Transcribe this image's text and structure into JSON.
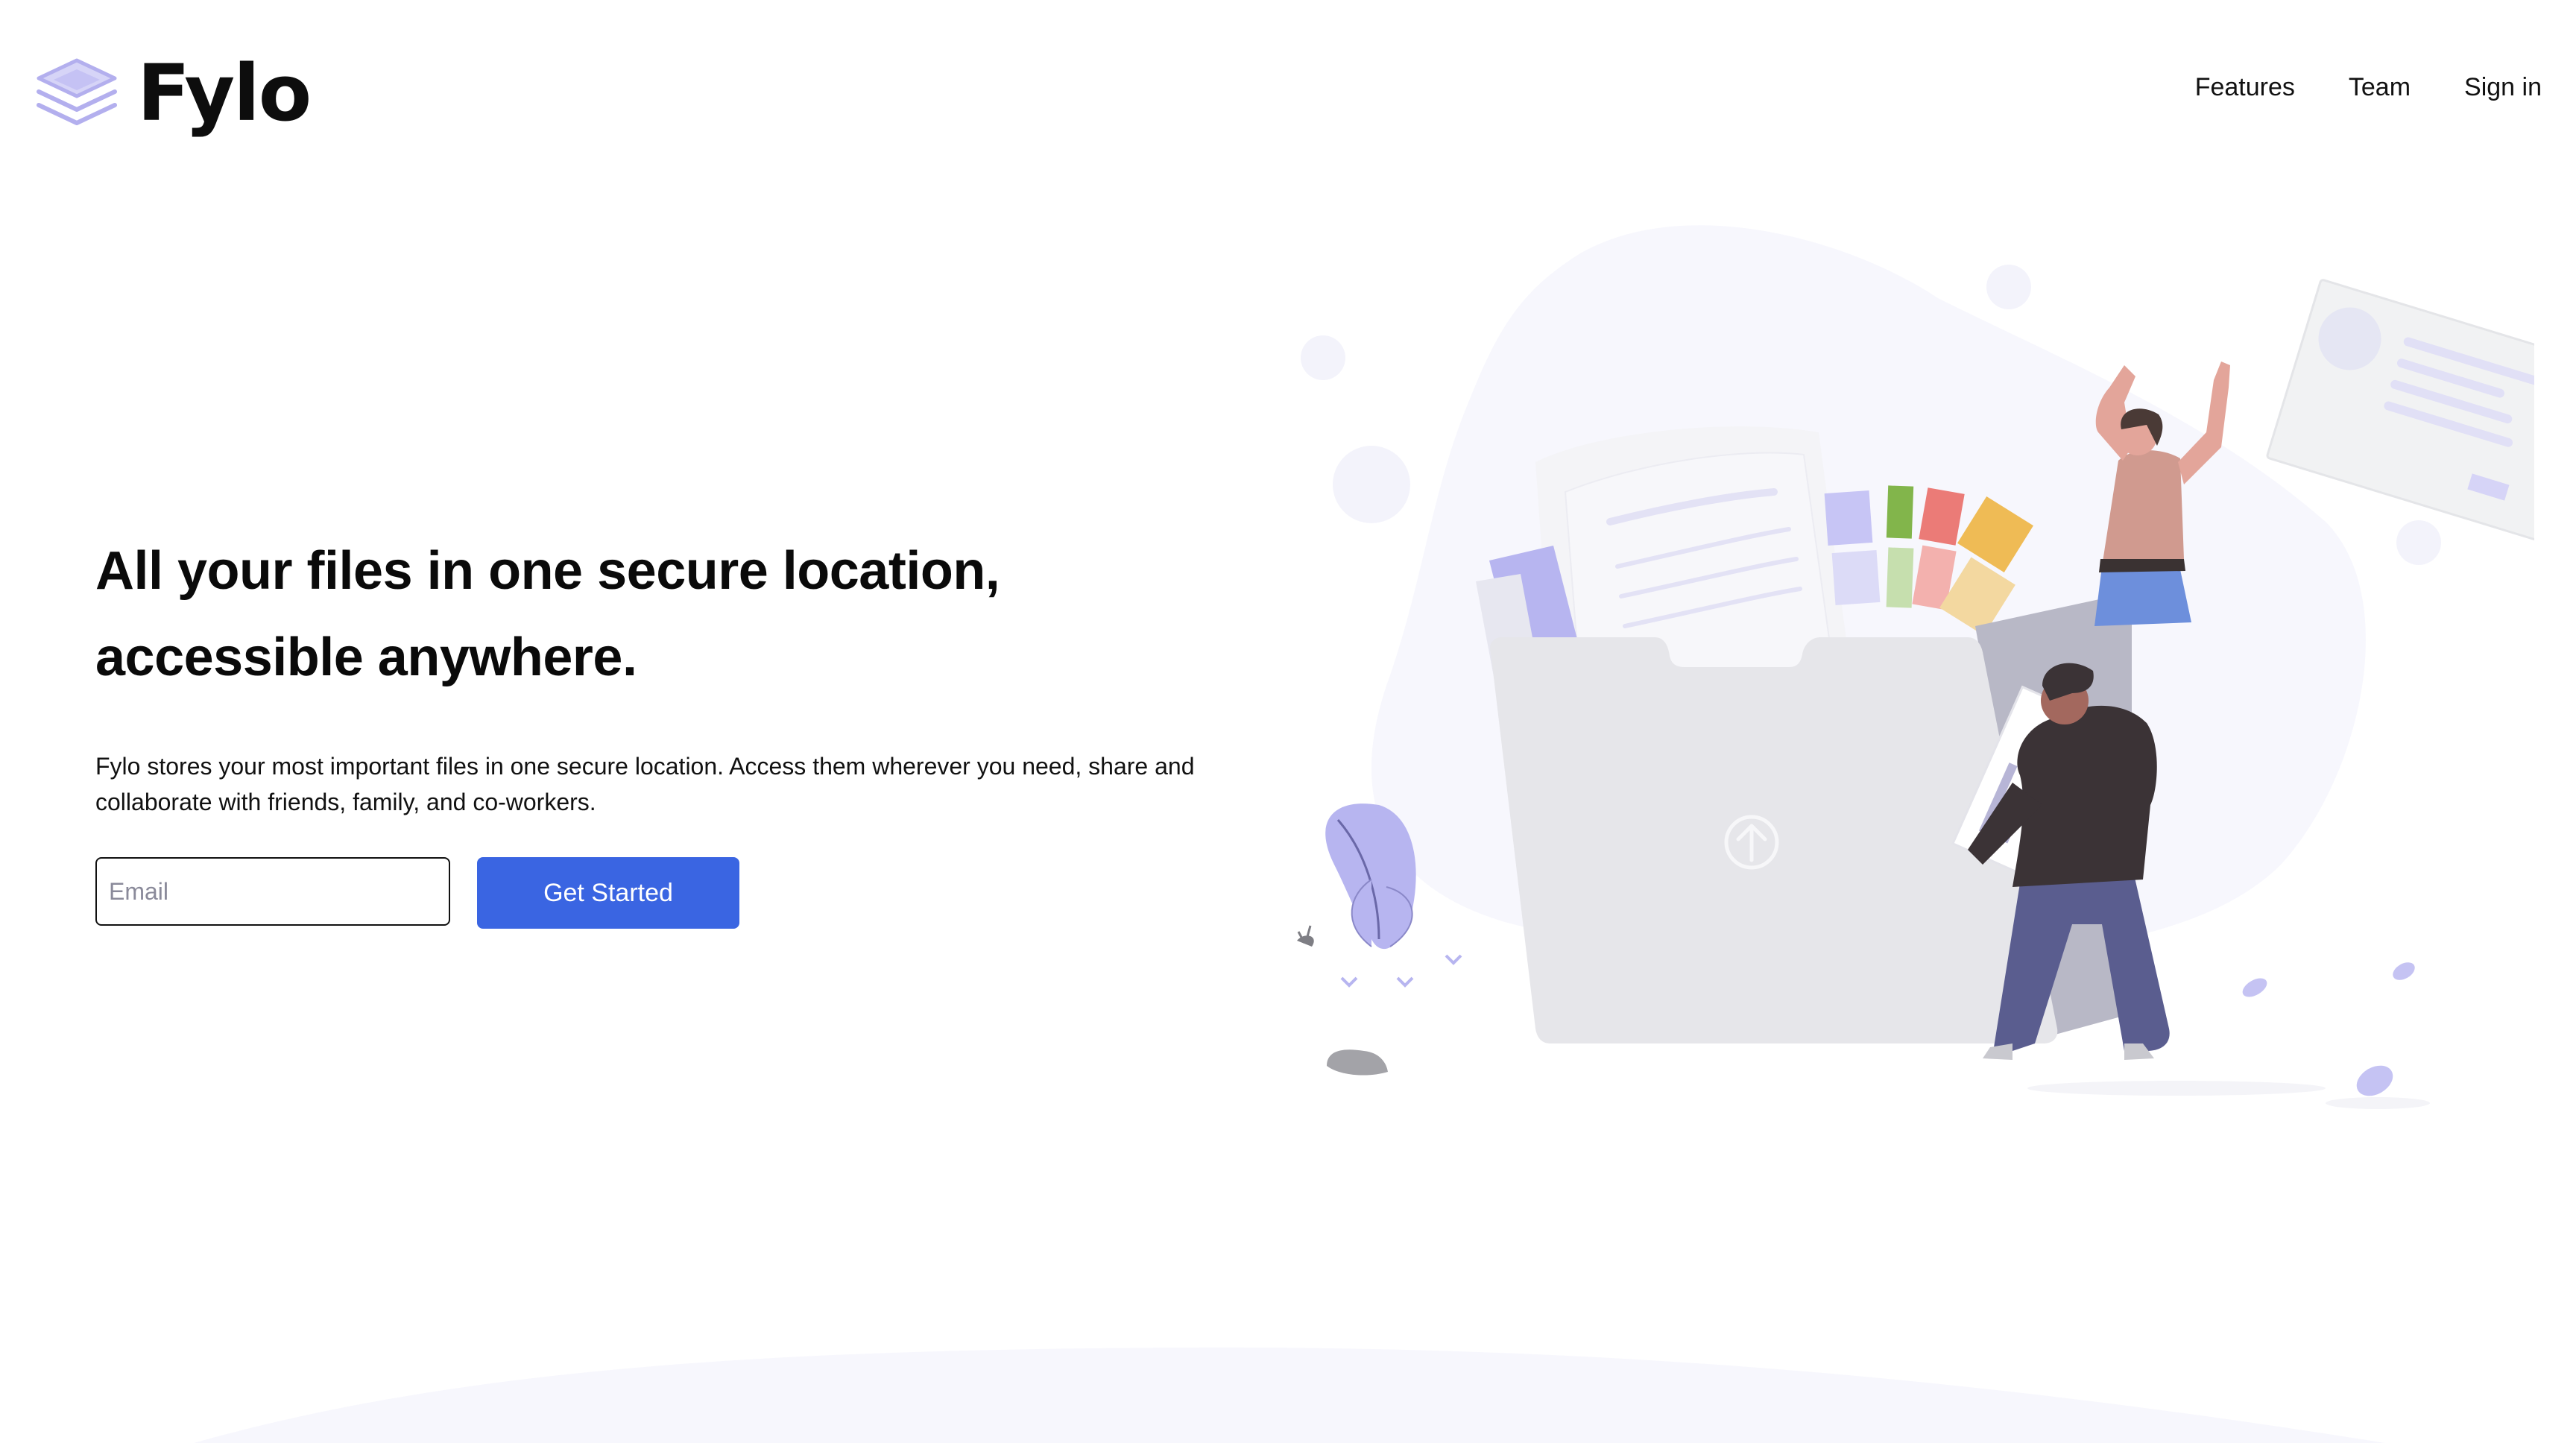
{
  "brand": {
    "name": "Fylo",
    "accent_color": "#3a65e2",
    "logo_icon": "stacked-layers-icon"
  },
  "nav": {
    "items": [
      {
        "label": "Features"
      },
      {
        "label": "Team"
      },
      {
        "label": "Sign in"
      }
    ]
  },
  "hero": {
    "title_line1": "All your files in one secure location,",
    "title_line2": "accessible anywhere.",
    "description_line1": "Fylo stores your most important files in one secure location. Access them wherever you need, share and",
    "description_line2": "collaborate with friends, family, and co-workers.",
    "email_placeholder": "Email",
    "cta_label": "Get Started"
  },
  "illustration": {
    "icon": "upload-arrow-icon"
  }
}
